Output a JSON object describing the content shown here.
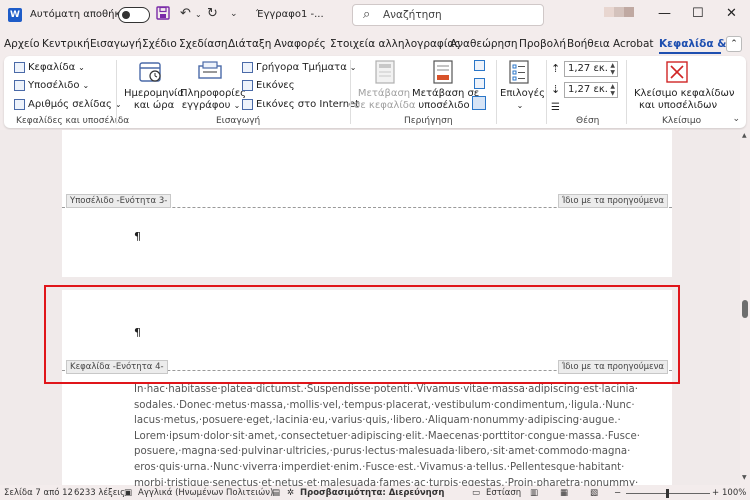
{
  "titlebar": {
    "autosave_label": "Αυτόματη αποθήκευση",
    "doc_title": "Έγγραφο1 -...",
    "search_placeholder": "Αναζήτηση",
    "minimize": "—",
    "maximize": "☐",
    "close": "✕"
  },
  "tabs": [
    "Αρχείο",
    "Κεντρική",
    "Εισαγωγή",
    "Σχέδιο",
    "Σχεδίαση",
    "Διάταξη",
    "Αναφορές",
    "Στοιχεία αλληλογραφίας",
    "Αναθεώρηση",
    "Προβολή",
    "Βοήθεια",
    "Acrobat",
    "Κεφαλίδα & υ"
  ],
  "active_tab": "Κεφαλίδα & υ",
  "ribbon": {
    "hf_group": {
      "header": "Κεφαλίδα",
      "footer": "Υποσέλιδο",
      "page_number": "Αριθμός σελίδας",
      "label": "Κεφαλίδες και υποσέλιδα"
    },
    "insert_group": {
      "date_time": [
        "Ημερομηνία",
        "και ώρα"
      ],
      "doc_info": [
        "Πληροφορίες",
        "εγγράφου"
      ],
      "quick_parts": "Γρήγορα Τμήματα",
      "pictures": "Εικόνες",
      "online_pictures": "Εικόνες στο Internet",
      "label": "Εισαγωγή"
    },
    "nav_group": {
      "goto_header": [
        "Μετάβαση",
        "σε κεφαλίδα"
      ],
      "goto_footer": [
        "Μετάβαση σε",
        "υποσέλιδο"
      ],
      "label": "Περιήγηση"
    },
    "options_group": {
      "options": "Επιλογές"
    },
    "position_group": {
      "header_pos": "1,27 εκ.",
      "footer_pos": "1,27 εκ.",
      "label": "Θέση"
    },
    "close_group": {
      "close_hf": [
        "Κλείσιμο κεφαλίδων",
        "και υποσέλιδων"
      ],
      "label": "Κλείσιμο"
    }
  },
  "document": {
    "footer_tag_3": "Υποσέλιδο -Ενότητα 3-",
    "same_as_previous_1": "Ίδιο με τα προηγούμενα",
    "header_tag_4": "Κεφαλίδα -Ενότητα 4-",
    "same_as_previous_2": "Ίδιο με τα προηγούμενα",
    "pilcrow": "¶",
    "body_lines": [
      "In·hac·habitasse·platea·dictumst.·Suspendisse·potenti.·Vivamus·vitae·massa·adipiscing·est·lacinia·",
      "sodales.·Donec·metus·massa,·mollis·vel,·tempus·placerat,·vestibulum·condimentum,·ligula.·Nunc·",
      "lacus·metus,·posuere·eget,·lacinia·eu,·varius·quis,·libero.·Aliquam·nonummy·adipiscing·augue.·",
      "Lorem·ipsum·dolor·sit·amet,·consectetuer·adipiscing·elit.·Maecenas·porttitor·congue·massa.·Fusce·",
      "posuere,·magna·sed·pulvinar·ultricies,·purus·lectus·malesuada·libero,·sit·amet·commodo·magna·",
      "eros·quis·urna.·Nunc·viverra·imperdiet·enim.·Fusce·est.·Vivamus·a·tellus.·Pellentesque·habitant·",
      "morbi·tristique·senectus·et·netus·et·malesuada·fames·ac·turpis·egestas.·Proin·pharetra·nonummy·"
    ]
  },
  "statusbar": {
    "page": "Σελίδα 7 από 12",
    "words": "6233 λέξεις",
    "language": "Αγγλικά (Ηνωμένων Πολιτειών)",
    "accessibility": "Προσβασιμότητα: Διερεύνηση",
    "focus": "Εστίαση",
    "zoom": "100%"
  },
  "colors": {
    "accent": "#1e4fb0",
    "highlight": "#e0151a"
  }
}
